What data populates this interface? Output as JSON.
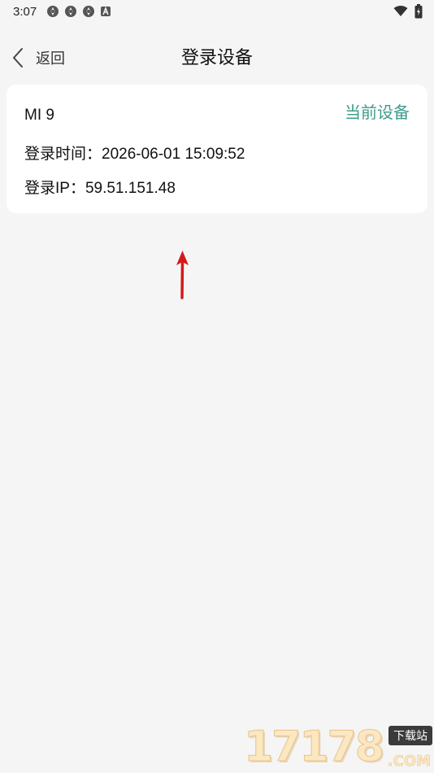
{
  "status_bar": {
    "time": "3:07",
    "icons": [
      "sync-icon",
      "sync-icon",
      "sync-icon",
      "a-notification-icon"
    ],
    "right_icons": [
      "wifi-icon",
      "battery-icon"
    ]
  },
  "header": {
    "back_label": "返回",
    "title": "登录设备"
  },
  "device_card": {
    "device_name": "MI 9",
    "current_badge": "当前设备",
    "login_time": "登录时间：2026-06-01 15:09:52",
    "login_ip": "登录IP：59.51.151.48"
  },
  "annotation": {
    "arrow_color": "#d31a1a"
  },
  "watermark": {
    "digits": "17178",
    "tag": "下载站",
    "suffix": ".COM"
  },
  "colors": {
    "background": "#f5f5f5",
    "card": "#ffffff",
    "accent": "#3f9c8c"
  }
}
